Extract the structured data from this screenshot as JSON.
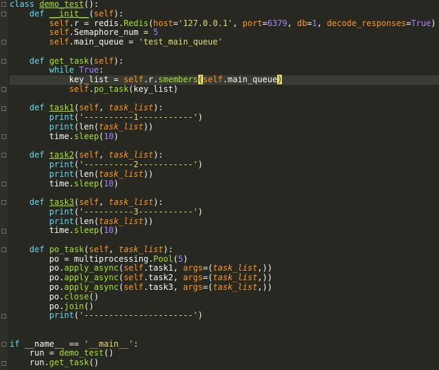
{
  "lines": [
    [
      [
        "kw",
        "class"
      ],
      [
        "t",
        " "
      ],
      [
        "fnu",
        "demo_test"
      ],
      [
        "t",
        "():"
      ]
    ],
    [
      [
        "t",
        "    "
      ],
      [
        "kw",
        "def"
      ],
      [
        "t",
        " "
      ],
      [
        "dunder",
        "__init__"
      ],
      [
        "t",
        "("
      ],
      [
        "self",
        "self"
      ],
      [
        "t",
        "):"
      ]
    ],
    [
      [
        "t",
        "        "
      ],
      [
        "self",
        "self"
      ],
      [
        "t",
        ".r = redis."
      ],
      [
        "fn",
        "Redis"
      ],
      [
        "t",
        "("
      ],
      [
        "kwarg",
        "host"
      ],
      [
        "t",
        "="
      ],
      [
        "str",
        "'127.0.0.1'"
      ],
      [
        "t",
        ", "
      ],
      [
        "kwarg",
        "port"
      ],
      [
        "t",
        "="
      ],
      [
        "num",
        "6379"
      ],
      [
        "t",
        ", "
      ],
      [
        "kwarg",
        "db"
      ],
      [
        "t",
        "="
      ],
      [
        "num",
        "1"
      ],
      [
        "t",
        ", "
      ],
      [
        "kwarg",
        "decode_responses"
      ],
      [
        "t",
        "="
      ],
      [
        "tru",
        "True"
      ],
      [
        "t",
        ")"
      ]
    ],
    [
      [
        "t",
        "        "
      ],
      [
        "self",
        "self"
      ],
      [
        "t",
        ".Semaphore_num = "
      ],
      [
        "num",
        "5"
      ]
    ],
    [
      [
        "t",
        "        "
      ],
      [
        "self",
        "self"
      ],
      [
        "t",
        ".main_queue = "
      ],
      [
        "str",
        "'test_main_queue'"
      ]
    ],
    [
      [
        "t",
        ""
      ]
    ],
    [
      [
        "t",
        "    "
      ],
      [
        "kw",
        "def"
      ],
      [
        "t",
        " "
      ],
      [
        "fn",
        "get_task"
      ],
      [
        "t",
        "("
      ],
      [
        "self",
        "self"
      ],
      [
        "t",
        "):"
      ]
    ],
    [
      [
        "t",
        "        "
      ],
      [
        "kw",
        "while"
      ],
      [
        "t",
        " "
      ],
      [
        "tru",
        "True"
      ],
      [
        "t",
        ":"
      ]
    ],
    [
      [
        "t",
        "            key_list = "
      ],
      [
        "self",
        "self"
      ],
      [
        "t",
        ".r."
      ],
      [
        "fn",
        "smembers"
      ],
      [
        "hl",
        "("
      ],
      [
        "self",
        "self"
      ],
      [
        "t",
        ".main_queue"
      ],
      [
        "hl",
        ")"
      ]
    ],
    [
      [
        "t",
        "            "
      ],
      [
        "self",
        "self"
      ],
      [
        "t",
        "."
      ],
      [
        "fn",
        "po_task"
      ],
      [
        "t",
        "(key_list)"
      ]
    ],
    [
      [
        "t",
        ""
      ]
    ],
    [
      [
        "t",
        "    "
      ],
      [
        "kw",
        "def"
      ],
      [
        "t",
        " "
      ],
      [
        "fnu",
        "task1"
      ],
      [
        "t",
        "("
      ],
      [
        "self",
        "self"
      ],
      [
        "t",
        ", "
      ],
      [
        "param",
        "task_list"
      ],
      [
        "t",
        "):"
      ]
    ],
    [
      [
        "t",
        "        "
      ],
      [
        "kw",
        "print"
      ],
      [
        "t",
        "("
      ],
      [
        "str",
        "'----------1-----------'"
      ],
      [
        "t",
        ")"
      ]
    ],
    [
      [
        "t",
        "        "
      ],
      [
        "kw",
        "print"
      ],
      [
        "t",
        "(len("
      ],
      [
        "param",
        "task_list"
      ],
      [
        "t",
        "))"
      ]
    ],
    [
      [
        "t",
        "        time."
      ],
      [
        "fn",
        "sleep"
      ],
      [
        "t",
        "("
      ],
      [
        "num",
        "10"
      ],
      [
        "t",
        ")"
      ]
    ],
    [
      [
        "t",
        ""
      ]
    ],
    [
      [
        "t",
        "    "
      ],
      [
        "kw",
        "def"
      ],
      [
        "t",
        " "
      ],
      [
        "fnu",
        "task2"
      ],
      [
        "t",
        "("
      ],
      [
        "self",
        "self"
      ],
      [
        "t",
        ", "
      ],
      [
        "param",
        "task_list"
      ],
      [
        "t",
        "):"
      ]
    ],
    [
      [
        "t",
        "        "
      ],
      [
        "kw",
        "print"
      ],
      [
        "t",
        "("
      ],
      [
        "str",
        "'----------2-----------'"
      ],
      [
        "t",
        ")"
      ]
    ],
    [
      [
        "t",
        "        "
      ],
      [
        "kw",
        "print"
      ],
      [
        "t",
        "(len("
      ],
      [
        "param",
        "task_list"
      ],
      [
        "t",
        "))"
      ]
    ],
    [
      [
        "t",
        "        time."
      ],
      [
        "fn",
        "sleep"
      ],
      [
        "t",
        "("
      ],
      [
        "num",
        "10"
      ],
      [
        "t",
        ")"
      ]
    ],
    [
      [
        "t",
        ""
      ]
    ],
    [
      [
        "t",
        "    "
      ],
      [
        "kw",
        "def"
      ],
      [
        "t",
        " "
      ],
      [
        "fnu",
        "task3"
      ],
      [
        "t",
        "("
      ],
      [
        "self",
        "self"
      ],
      [
        "t",
        ", "
      ],
      [
        "param",
        "task_list"
      ],
      [
        "t",
        "):"
      ]
    ],
    [
      [
        "t",
        "        "
      ],
      [
        "kw",
        "print"
      ],
      [
        "t",
        "("
      ],
      [
        "str",
        "'----------3-----------'"
      ],
      [
        "t",
        ")"
      ]
    ],
    [
      [
        "t",
        "        "
      ],
      [
        "kw",
        "print"
      ],
      [
        "t",
        "(len("
      ],
      [
        "param",
        "task_list"
      ],
      [
        "t",
        "))"
      ]
    ],
    [
      [
        "t",
        "        time."
      ],
      [
        "fn",
        "sleep"
      ],
      [
        "t",
        "("
      ],
      [
        "num",
        "10"
      ],
      [
        "t",
        ")"
      ]
    ],
    [
      [
        "t",
        ""
      ]
    ],
    [
      [
        "t",
        "    "
      ],
      [
        "kw",
        "def"
      ],
      [
        "t",
        " "
      ],
      [
        "fn",
        "po_task"
      ],
      [
        "t",
        "("
      ],
      [
        "self",
        "self"
      ],
      [
        "t",
        ", "
      ],
      [
        "param",
        "task_list"
      ],
      [
        "t",
        "):"
      ]
    ],
    [
      [
        "t",
        "        po = multiprocessing."
      ],
      [
        "fn",
        "Pool"
      ],
      [
        "t",
        "("
      ],
      [
        "num",
        "5"
      ],
      [
        "t",
        ")"
      ]
    ],
    [
      [
        "t",
        "        po."
      ],
      [
        "fn",
        "apply_async"
      ],
      [
        "t",
        "("
      ],
      [
        "self",
        "self"
      ],
      [
        "t",
        ".task1, "
      ],
      [
        "kwarg",
        "args"
      ],
      [
        "t",
        "=("
      ],
      [
        "param",
        "task_list"
      ],
      [
        "t",
        ",))"
      ]
    ],
    [
      [
        "t",
        "        po."
      ],
      [
        "fn",
        "apply_async"
      ],
      [
        "t",
        "("
      ],
      [
        "self",
        "self"
      ],
      [
        "t",
        ".task2, "
      ],
      [
        "kwarg",
        "args"
      ],
      [
        "t",
        "=("
      ],
      [
        "param",
        "task_list"
      ],
      [
        "t",
        ",))"
      ]
    ],
    [
      [
        "t",
        "        po."
      ],
      [
        "fn",
        "apply_async"
      ],
      [
        "t",
        "("
      ],
      [
        "self",
        "self"
      ],
      [
        "t",
        ".task3, "
      ],
      [
        "kwarg",
        "args"
      ],
      [
        "t",
        "=("
      ],
      [
        "param",
        "task_list"
      ],
      [
        "t",
        ",))"
      ]
    ],
    [
      [
        "t",
        "        po."
      ],
      [
        "fn",
        "close"
      ],
      [
        "t",
        "()"
      ]
    ],
    [
      [
        "t",
        "        po."
      ],
      [
        "fn",
        "join"
      ],
      [
        "t",
        "()"
      ]
    ],
    [
      [
        "t",
        "        "
      ],
      [
        "kw",
        "print"
      ],
      [
        "t",
        "("
      ],
      [
        "str",
        "'----------------------'"
      ],
      [
        "t",
        ")"
      ]
    ],
    [
      [
        "t",
        ""
      ]
    ],
    [
      [
        "t",
        ""
      ]
    ],
    [
      [
        "kw",
        "if"
      ],
      [
        "t",
        " __name__ == "
      ],
      [
        "str",
        "'__main__'"
      ],
      [
        "t",
        ":"
      ]
    ],
    [
      [
        "t",
        "    run = "
      ],
      [
        "fn",
        "demo_test"
      ],
      [
        "t",
        "()"
      ]
    ],
    [
      [
        "t",
        "    run."
      ],
      [
        "fn",
        "get_task"
      ],
      [
        "t",
        "()"
      ]
    ]
  ],
  "current_line": 8,
  "fold_lines": [
    0,
    1,
    4,
    6,
    9,
    11,
    14,
    16,
    19,
    21,
    24,
    26,
    33,
    36,
    38
  ]
}
